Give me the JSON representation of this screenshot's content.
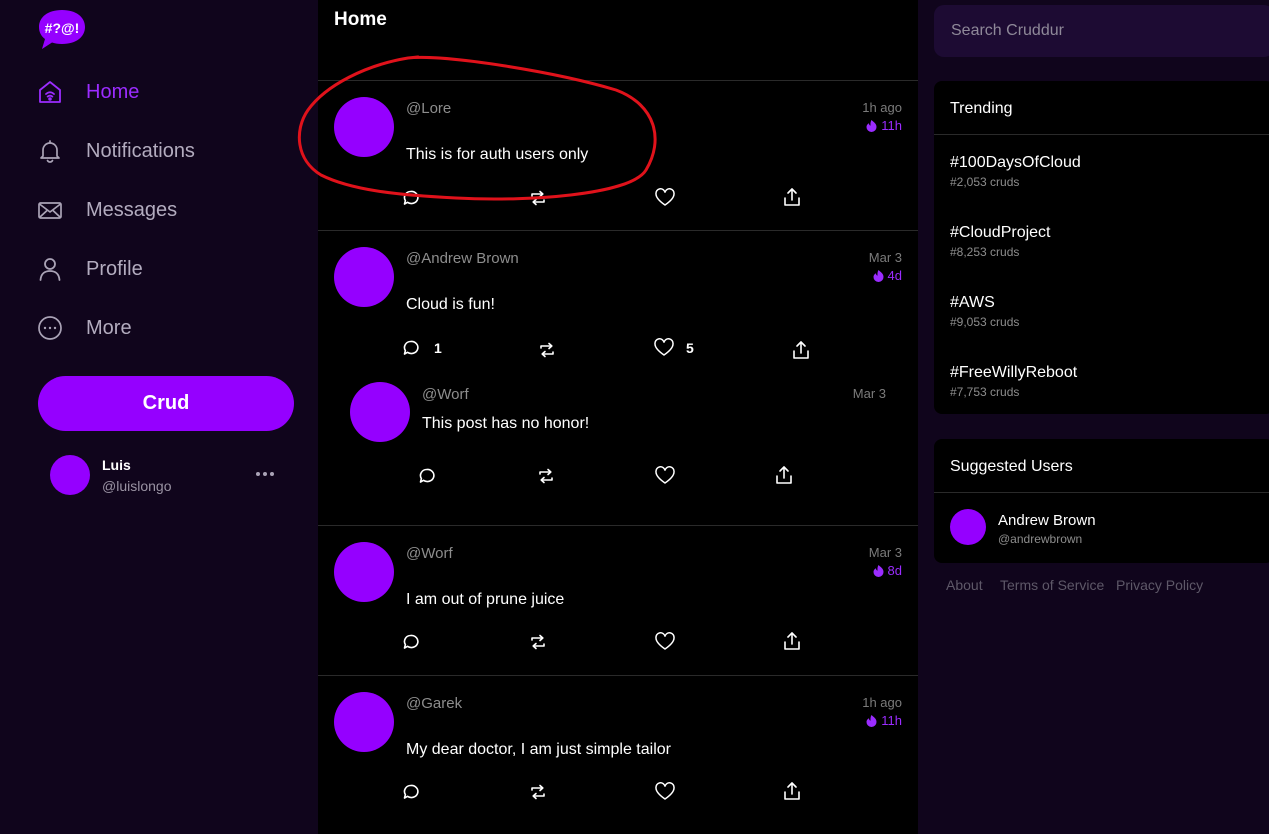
{
  "colors": {
    "accent": "#9500ff",
    "sidebar_bg": "#10051c",
    "feed_bg": "#000000",
    "annotation": "#e0121b"
  },
  "logo": {
    "text": "#?@!"
  },
  "nav": [
    {
      "label": "Home",
      "icon": "home-icon",
      "active": true
    },
    {
      "label": "Notifications",
      "icon": "bell-icon",
      "active": false
    },
    {
      "label": "Messages",
      "icon": "mail-icon",
      "active": false
    },
    {
      "label": "Profile",
      "icon": "user-icon",
      "active": false
    },
    {
      "label": "More",
      "icon": "more-circle-icon",
      "active": false
    }
  ],
  "crud_button": {
    "label": "Crud"
  },
  "profile": {
    "name": "Luis",
    "handle": "@luislongo",
    "menu_icon": "ellipsis-icon"
  },
  "main": {
    "title": "Home"
  },
  "activities": [
    {
      "handle": "@Lore",
      "message": "This is for auth users only",
      "time": "1h ago",
      "expires": "11h",
      "replies": "",
      "reposts": "",
      "likes": ""
    },
    {
      "handle": "@Andrew Brown",
      "message": "Cloud is fun!",
      "time": "Mar 3",
      "expires": "4d",
      "replies": "1",
      "reposts": "",
      "likes": "5",
      "reply": {
        "handle": "@Worf",
        "message": "This post has no honor!",
        "time": "Mar 3"
      }
    },
    {
      "handle": "@Worf",
      "message": "I am out of prune juice",
      "time": "Mar 3",
      "expires": "8d",
      "replies": "",
      "reposts": "",
      "likes": ""
    },
    {
      "handle": "@Garek",
      "message": "My dear doctor, I am just simple tailor",
      "time": "1h ago",
      "expires": "11h",
      "replies": "",
      "reposts": "",
      "likes": ""
    }
  ],
  "search": {
    "placeholder": "Search Cruddur",
    "value": ""
  },
  "trending": {
    "title": "Trending",
    "items": [
      {
        "tag": "#100DaysOfCloud",
        "count": "#2,053 cruds"
      },
      {
        "tag": "#CloudProject",
        "count": "#8,253 cruds"
      },
      {
        "tag": "#AWS",
        "count": "#9,053 cruds"
      },
      {
        "tag": "#FreeWillyReboot",
        "count": "#7,753 cruds"
      }
    ]
  },
  "suggested": {
    "title": "Suggested Users",
    "users": [
      {
        "name": "Andrew Brown",
        "handle": "@andrewbrown"
      }
    ]
  },
  "footer": {
    "about": "About",
    "terms": "Terms of Service",
    "privacy": "Privacy Policy"
  }
}
